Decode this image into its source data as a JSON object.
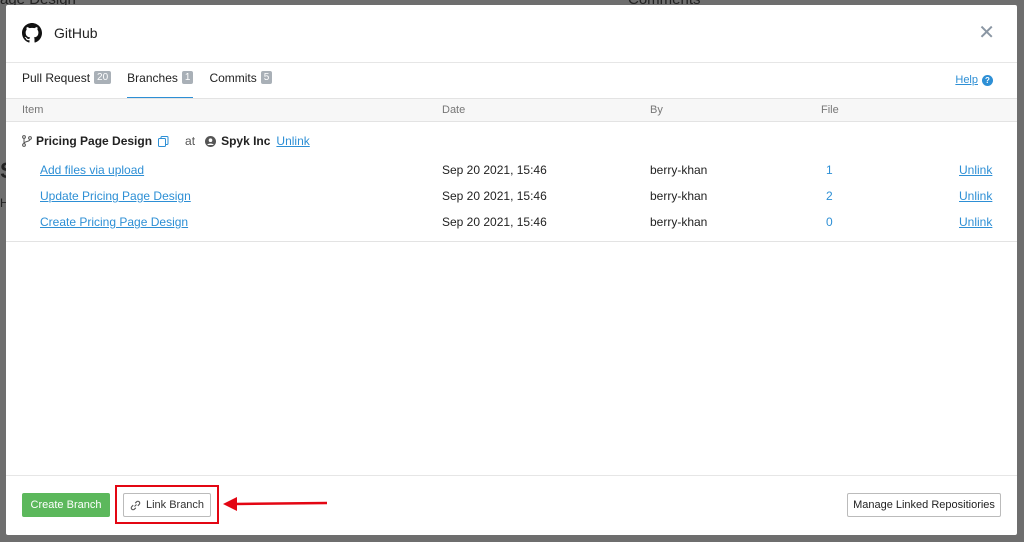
{
  "background": {
    "left_text": "age Design",
    "right_text": "Comments",
    "frag1": "S",
    "frag2": "H"
  },
  "modal": {
    "title": "GitHub",
    "icon": "github-icon",
    "close_icon": "close-icon"
  },
  "tabs": [
    {
      "label": "Pull Request",
      "count": "20"
    },
    {
      "label": "Branches",
      "count": "1"
    },
    {
      "label": "Commits",
      "count": "5"
    }
  ],
  "help": {
    "label": "Help",
    "icon": "question-icon"
  },
  "columns": {
    "item": "Item",
    "date": "Date",
    "by": "By",
    "file": "File"
  },
  "group": {
    "branch": "Pricing Page Design",
    "at": "at",
    "org": "Spyk Inc",
    "unlink": "Unlink"
  },
  "rows": [
    {
      "item": "Add files via upload",
      "date": "Sep 20 2021, 15:46",
      "by": "berry-khan",
      "file": "1",
      "action": "Unlink"
    },
    {
      "item": "Update Pricing Page Design",
      "date": "Sep 20 2021, 15:46",
      "by": "berry-khan",
      "file": "2",
      "action": "Unlink"
    },
    {
      "item": "Create Pricing Page Design",
      "date": "Sep 20 2021, 15:46",
      "by": "berry-khan",
      "file": "0",
      "action": "Unlink"
    }
  ],
  "footer": {
    "create_branch": "Create Branch",
    "link_branch": "Link Branch",
    "manage": "Manage Linked Repositiories"
  },
  "colors": {
    "accent": "#2d8fd5",
    "create_button": "#5cb85c",
    "annotation": "#e30613"
  }
}
